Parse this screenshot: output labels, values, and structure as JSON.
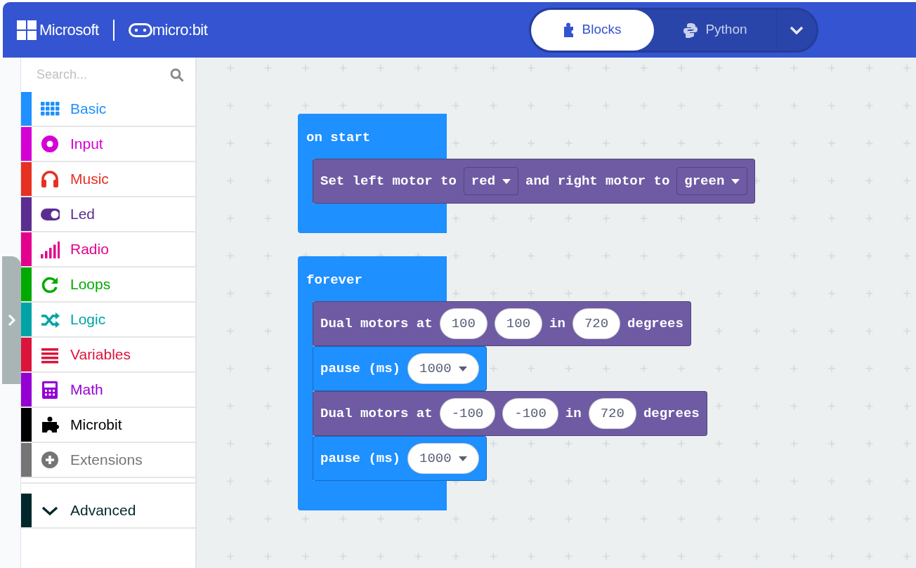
{
  "header": {
    "brand": "Microsoft",
    "product": "micro:bit",
    "editor_tabs": [
      {
        "label": "Blocks",
        "kind": "blocks",
        "selected": true
      },
      {
        "label": "Python",
        "kind": "python",
        "selected": false
      }
    ]
  },
  "toolbox": {
    "search": {
      "placeholder": "Search..."
    },
    "categories": [
      {
        "label": "Basic",
        "kind": "grid",
        "color": "#1e90ff"
      },
      {
        "label": "Input",
        "kind": "ring",
        "color": "#d400d4"
      },
      {
        "label": "Music",
        "kind": "headphones",
        "color": "#e63022"
      },
      {
        "label": "Led",
        "kind": "toggle",
        "color": "#5c2d91"
      },
      {
        "label": "Radio",
        "kind": "signal",
        "color": "#e3008c"
      },
      {
        "label": "Loops",
        "kind": "loop",
        "color": "#00aa00"
      },
      {
        "label": "Logic",
        "kind": "shuffle",
        "color": "#00a4a6"
      },
      {
        "label": "Variables",
        "kind": "lines",
        "color": "#dc143c"
      },
      {
        "label": "Math",
        "kind": "calculator",
        "color": "#9400d3"
      },
      {
        "label": "Microbit",
        "kind": "puzzle",
        "color": "#000000"
      },
      {
        "label": "Extensions",
        "kind": "plus",
        "color": "#757575"
      }
    ],
    "advanced": {
      "label": "Advanced",
      "kind": "chevron",
      "color": "#00272b"
    }
  },
  "workspace": {
    "blocks": [
      {
        "kind": "event",
        "label": "on start",
        "children": [
          {
            "kind": "statement",
            "color": "#6e5ba4",
            "parts": [
              {
                "kind": "text",
                "text": "Set left motor to"
              },
              {
                "kind": "dropdown",
                "text": "red"
              },
              {
                "kind": "text",
                "text": "and right motor to"
              },
              {
                "kind": "dropdown",
                "text": "green"
              }
            ]
          }
        ]
      },
      {
        "kind": "event",
        "label": "forever",
        "children": [
          {
            "kind": "statement",
            "color": "#6e5ba4",
            "parts": [
              {
                "kind": "text",
                "text": "Dual motors at"
              },
              {
                "kind": "number",
                "text": "100"
              },
              {
                "kind": "number",
                "text": "100"
              },
              {
                "kind": "text",
                "text": "in"
              },
              {
                "kind": "number",
                "text": "720"
              },
              {
                "kind": "text",
                "text": "degrees"
              }
            ]
          },
          {
            "kind": "statement",
            "color": "#1e90ff",
            "parts": [
              {
                "kind": "text",
                "text": "pause (ms)"
              },
              {
                "kind": "number-dropdown",
                "text": "1000"
              }
            ]
          },
          {
            "kind": "statement",
            "color": "#6e5ba4",
            "parts": [
              {
                "kind": "text",
                "text": "Dual motors at"
              },
              {
                "kind": "number",
                "text": "-100"
              },
              {
                "kind": "number",
                "text": "-100"
              },
              {
                "kind": "text",
                "text": "in"
              },
              {
                "kind": "number",
                "text": "720"
              },
              {
                "kind": "text",
                "text": "degrees"
              }
            ]
          },
          {
            "kind": "statement",
            "color": "#1e90ff",
            "parts": [
              {
                "kind": "text",
                "text": "pause (ms)"
              },
              {
                "kind": "number-dropdown",
                "text": "1000"
              }
            ]
          }
        ]
      }
    ]
  }
}
